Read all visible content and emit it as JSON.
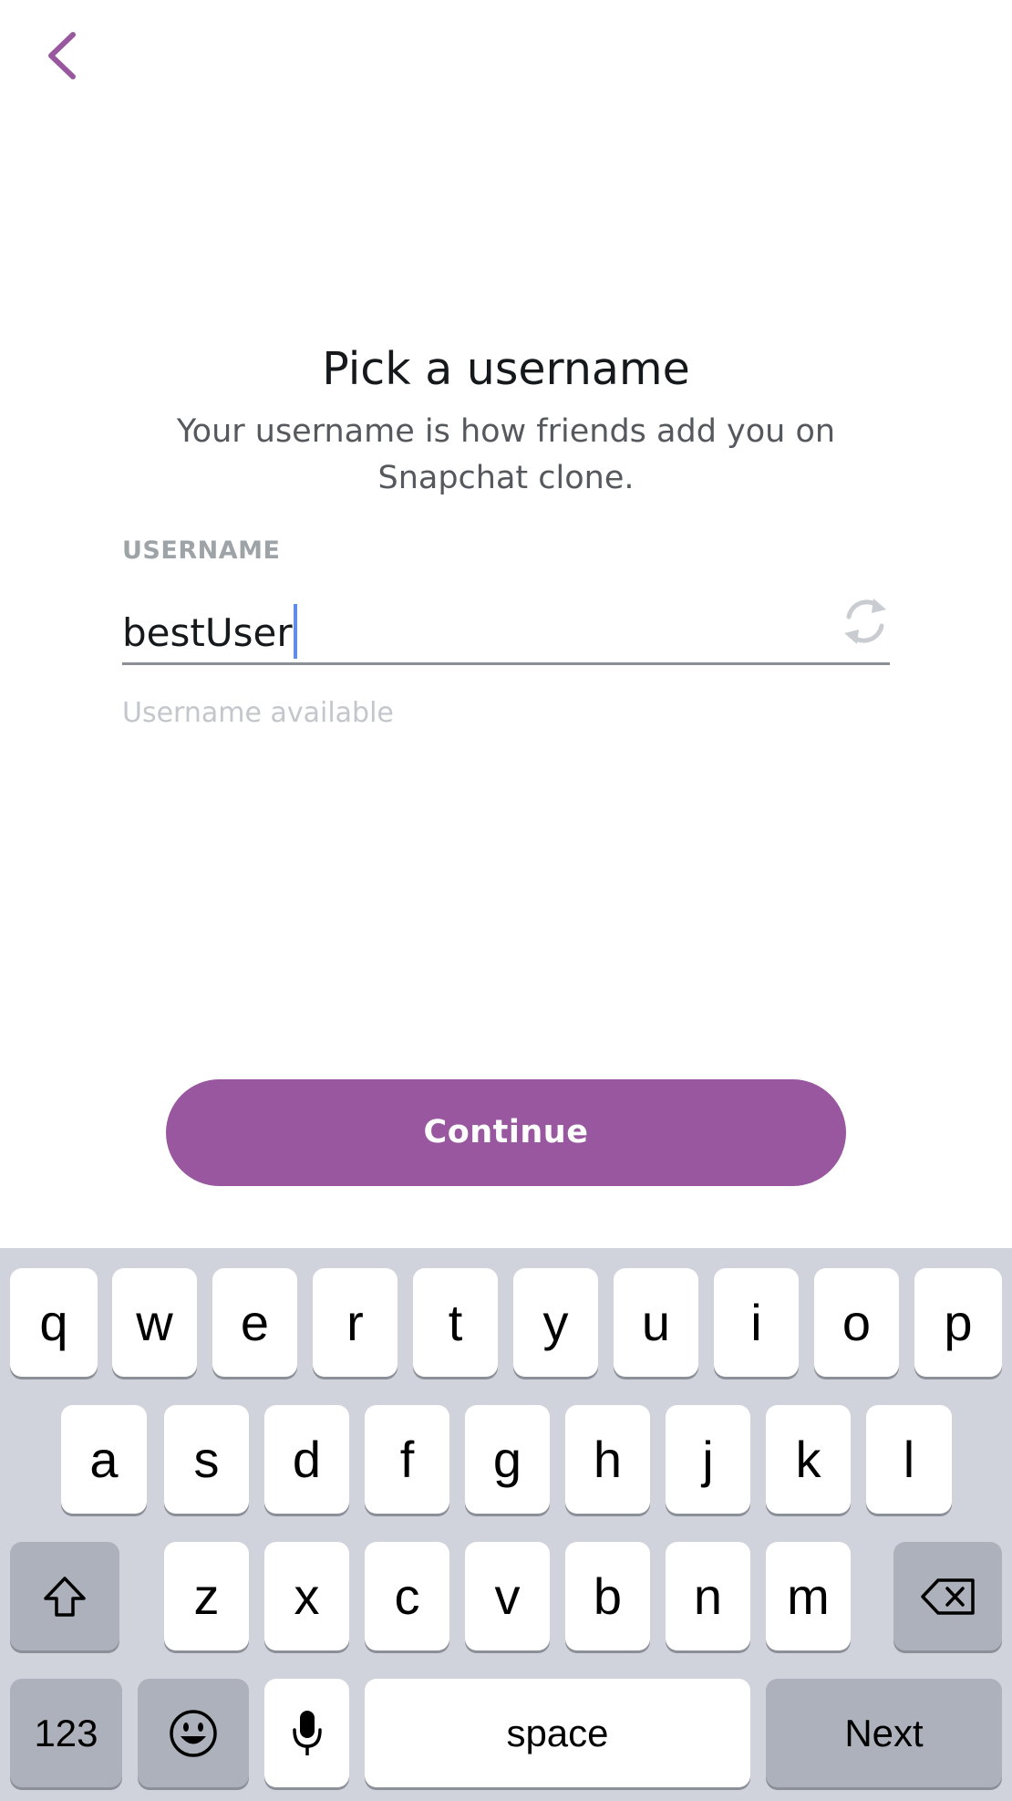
{
  "header": {
    "back_icon": "chevron-left-icon"
  },
  "title": "Pick a username",
  "subtitle": "Your username is how friends add you on Snapchat clone.",
  "username_field": {
    "label": "USERNAME",
    "value": "bestUser",
    "refresh_icon": "refresh-icon",
    "helper": "Username available"
  },
  "continue_label": "Continue",
  "colors": {
    "accent": "#98579e",
    "caret": "#5f8ce8"
  },
  "keyboard": {
    "row1": [
      "q",
      "w",
      "e",
      "r",
      "t",
      "y",
      "u",
      "i",
      "o",
      "p"
    ],
    "row2": [
      "a",
      "s",
      "d",
      "f",
      "g",
      "h",
      "j",
      "k",
      "l"
    ],
    "row3": [
      "z",
      "x",
      "c",
      "v",
      "b",
      "n",
      "m"
    ],
    "shift_icon": "shift-icon",
    "delete_icon": "backspace-icon",
    "numbers_label": "123",
    "emoji_icon": "emoji-icon",
    "mic_icon": "microphone-icon",
    "space_label": "space",
    "next_label": "Next"
  }
}
